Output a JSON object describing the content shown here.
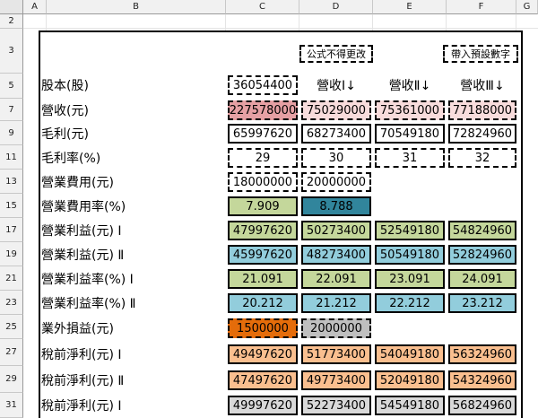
{
  "columns": [
    "A",
    "B",
    "C",
    "D",
    "E",
    "F",
    "G"
  ],
  "rows": [
    "2",
    "3",
    "5",
    "7",
    "9",
    "11",
    "13",
    "15",
    "17",
    "19",
    "21",
    "23",
    "25",
    "27",
    "29",
    "31"
  ],
  "notes": {
    "formula_locked": "公式不得更改",
    "default_input": "帶入預設數字"
  },
  "header": {
    "share_capital_value": "36054400",
    "rev1": "營收Ⅰ↓",
    "rev2": "營收Ⅱ↓",
    "rev3": "營收Ⅲ↓"
  },
  "colors": {
    "pink_strong": "#e6a0a4",
    "pink_light": "#f8dcdc",
    "teal": "#31859c",
    "green": "#c4d79b",
    "blue": "#92cddc",
    "orange_strong": "#e46c0a",
    "gray": "#bfbfbf",
    "orange_light": "#fabf8f",
    "light_gray": "#d9d9d9",
    "white": "#ffffff"
  },
  "table": [
    {
      "label": "股本(股)",
      "cells": []
    },
    {
      "label": "營收(元)",
      "cells": [
        "227578000",
        "75029000",
        "75361000",
        "77188000"
      ]
    },
    {
      "label": "毛利(元)",
      "cells": [
        "65997620",
        "68273400",
        "70549180",
        "72824960"
      ]
    },
    {
      "label": "毛利率(%)",
      "cells": [
        "29",
        "30",
        "31",
        "32"
      ]
    },
    {
      "label": "營業費用(元)",
      "cells": [
        "18000000",
        "20000000"
      ]
    },
    {
      "label": "營業費用率(%)",
      "cells": [
        "7.909",
        "8.788"
      ]
    },
    {
      "label": "營業利益(元) Ⅰ",
      "cells": [
        "47997620",
        "50273400",
        "52549180",
        "54824960"
      ]
    },
    {
      "label": "營業利益(元) Ⅱ",
      "cells": [
        "45997620",
        "48273400",
        "50549180",
        "52824960"
      ]
    },
    {
      "label": "營業利益率(%) Ⅰ",
      "cells": [
        "21.091",
        "22.091",
        "23.091",
        "24.091"
      ]
    },
    {
      "label": "營業利益率(%) Ⅱ",
      "cells": [
        "20.212",
        "21.212",
        "22.212",
        "23.212"
      ]
    },
    {
      "label": "業外損益(元)",
      "cells": [
        "1500000",
        "2000000"
      ]
    },
    {
      "label": "稅前淨利(元) Ⅰ",
      "cells": [
        "49497620",
        "51773400",
        "54049180",
        "56324960"
      ]
    },
    {
      "label": "稅前淨利(元) Ⅱ",
      "cells": [
        "47497620",
        "49773400",
        "52049180",
        "54324960"
      ]
    },
    {
      "label": "稅前淨利(元) Ⅰ",
      "cells": [
        "49997620",
        "52273400",
        "54549180",
        "56824960"
      ]
    }
  ]
}
